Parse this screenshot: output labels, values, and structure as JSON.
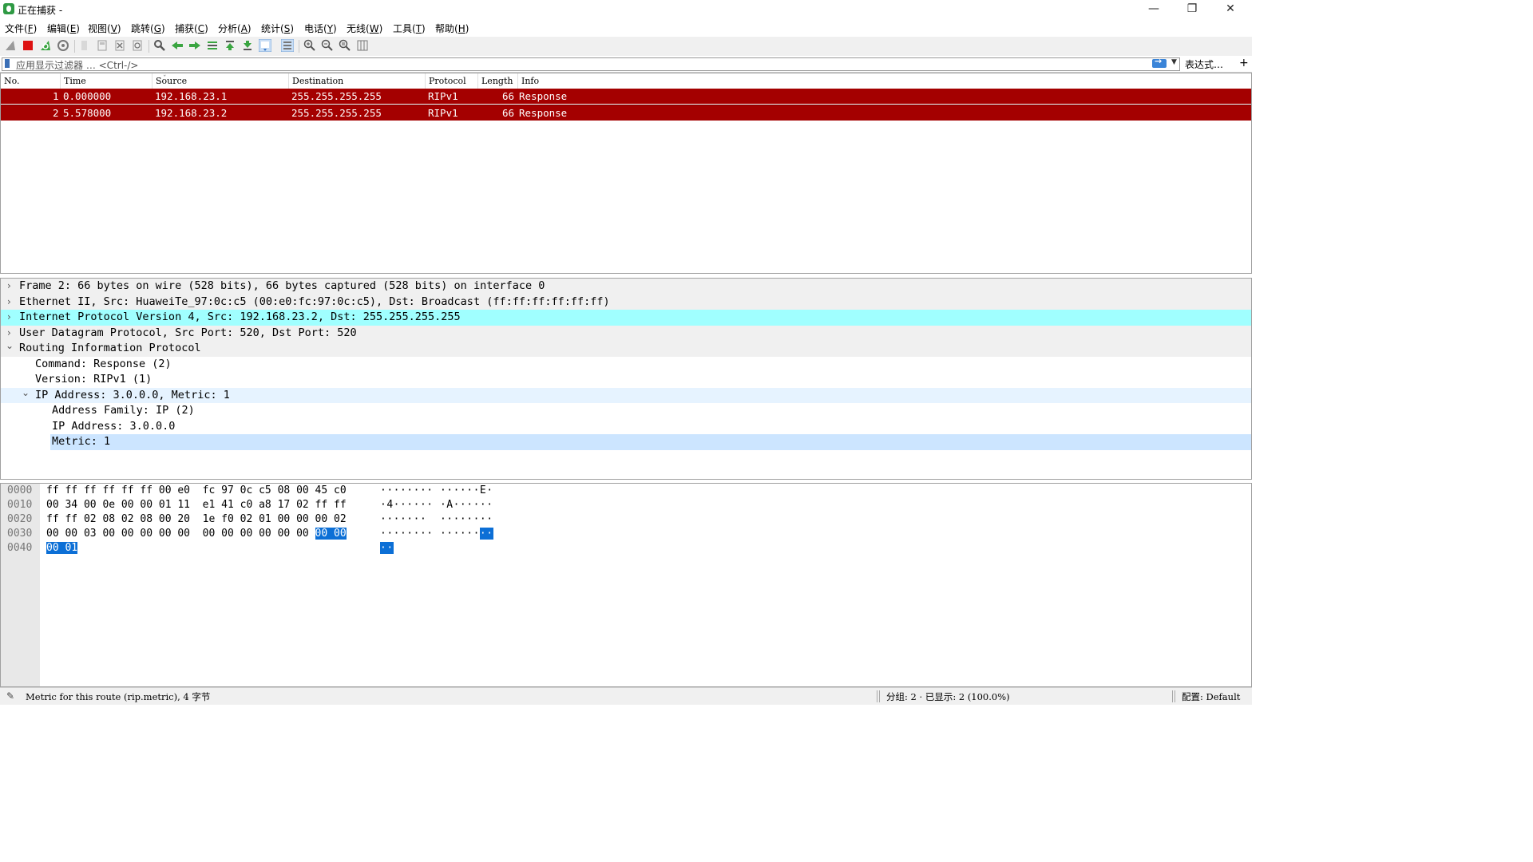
{
  "window": {
    "title": "正在捕获 -",
    "controls": [
      "—",
      "❐",
      "✕"
    ]
  },
  "menu": [
    {
      "label": "文件(",
      "key": "F",
      "end": ")"
    },
    {
      "label": "编辑(",
      "key": "E",
      "end": ")"
    },
    {
      "label": "视图(",
      "key": "V",
      "end": ")"
    },
    {
      "label": "跳转(",
      "key": "G",
      "end": ")"
    },
    {
      "label": "捕获(",
      "key": "C",
      "end": ")"
    },
    {
      "label": "分析(",
      "key": "A",
      "end": ")"
    },
    {
      "label": "统计(",
      "key": "S",
      "end": ")"
    },
    {
      "label": "电话(",
      "key": "Y",
      "end": ")"
    },
    {
      "label": "无线(",
      "key": "W",
      "end": ")"
    },
    {
      "label": "工具(",
      "key": "T",
      "end": ")"
    },
    {
      "label": "帮助(",
      "key": "H",
      "end": ")"
    }
  ],
  "toolbar": {
    "icons": [
      "shark-fin-start-icon",
      "stop-capture-icon",
      "restart-capture-icon",
      "capture-options-icon",
      "open-file-icon",
      "save-file-icon",
      "close-file-icon",
      "reload-file-icon",
      "find-packet-icon",
      "go-back-icon",
      "go-forward-icon",
      "go-to-packet-icon",
      "go-first-icon",
      "go-last-icon",
      "auto-scroll-icon",
      "colorize-icon",
      "zoom-in-icon",
      "zoom-out-icon",
      "zoom-reset-icon",
      "resize-columns-icon"
    ],
    "colors": {
      "stop": "#dd1111",
      "green": "#3aa541",
      "blue": "#3b78c8"
    }
  },
  "filter": {
    "placeholder": "应用显示过滤器 … <Ctrl-/>",
    "expression_label": "表达式…",
    "plus_label": "+"
  },
  "packet_list": {
    "columns": [
      "No.",
      "Time",
      "Source",
      "Destination",
      "Protocol",
      "Length",
      "Info"
    ],
    "row_color": "#a40000",
    "rows": [
      {
        "no": "1",
        "time": "0.000000",
        "source": "192.168.23.1",
        "destination": "255.255.255.255",
        "protocol": "RIPv1",
        "length": "66",
        "info": "Response",
        "selected": false
      },
      {
        "no": "2",
        "time": "5.578000",
        "source": "192.168.23.2",
        "destination": "255.255.255.255",
        "protocol": "RIPv1",
        "length": "66",
        "info": "Response",
        "selected": true
      }
    ]
  },
  "details": {
    "lines": [
      {
        "text": "Frame 2: 66 bytes on wire (528 bits), 66 bytes captured (528 bits) on interface 0",
        "indent": 0,
        "chevron": "›",
        "bg": "#f0f0f0"
      },
      {
        "text": "Ethernet II, Src: HuaweiTe_97:0c:c5 (00:e0:fc:97:0c:c5), Dst: Broadcast (ff:ff:ff:ff:ff:ff)",
        "indent": 0,
        "chevron": "›",
        "bg": "#f0f0f0"
      },
      {
        "text": "Internet Protocol Version 4, Src: 192.168.23.2, Dst: 255.255.255.255",
        "indent": 0,
        "chevron": "›",
        "bg": "#a0ffff"
      },
      {
        "text": "User Datagram Protocol, Src Port: 520, Dst Port: 520",
        "indent": 0,
        "chevron": "›",
        "bg": "#f0f0f0"
      },
      {
        "text": "Routing Information Protocol",
        "indent": 0,
        "chevron": "⌄",
        "bg": "#f0f0f0"
      },
      {
        "text": "Command: Response (2)",
        "indent": 1,
        "chevron": "",
        "bg": "#ffffff"
      },
      {
        "text": "Version: RIPv1 (1)",
        "indent": 1,
        "chevron": "",
        "bg": "#ffffff"
      },
      {
        "text": "IP Address: 3.0.0.0, Metric: 1",
        "indent": 1,
        "chevron": "⌄",
        "bg": "#e6f3ff"
      },
      {
        "text": "Address Family: IP (2)",
        "indent": 2,
        "chevron": "",
        "bg": "#ffffff"
      },
      {
        "text": "IP Address: 3.0.0.0",
        "indent": 2,
        "chevron": "",
        "bg": "#ffffff"
      },
      {
        "text": "Metric: 1",
        "indent": 2,
        "chevron": "",
        "bg": "#cce5ff"
      }
    ]
  },
  "hex": {
    "rows": [
      {
        "offset": "0000",
        "bytes": "ff ff ff ff ff ff 00 e0  fc 97 0c c5 08 00 45 c0",
        "bytes_hl": "",
        "ascii": "········ ······E·",
        "ascii_hl": ""
      },
      {
        "offset": "0010",
        "bytes": "00 34 00 0e 00 00 01 11  e1 41 c0 a8 17 02 ff ff",
        "bytes_hl": "",
        "ascii": "·4······ ·A······",
        "ascii_hl": ""
      },
      {
        "offset": "0020",
        "bytes": "ff ff 02 08 02 08 00 20  1e f0 02 01 00 00 00 02",
        "bytes_hl": "",
        "ascii": "·······  ········",
        "ascii_hl": ""
      },
      {
        "offset": "0030",
        "bytes": "00 00 03 00 00 00 00 00  00 00 00 00 00 00 ",
        "bytes_hl": "00 00",
        "ascii": "········ ······",
        "ascii_hl": "··"
      },
      {
        "offset": "0040",
        "bytes": "",
        "bytes_hl": "00 01",
        "ascii": "",
        "ascii_hl": "··"
      }
    ]
  },
  "status": {
    "field_text": "Metric for this route (rip.metric), 4 字节",
    "packets": "分组: 2 · 已显示: 2 (100.0%)",
    "profile": "配置: Default"
  }
}
